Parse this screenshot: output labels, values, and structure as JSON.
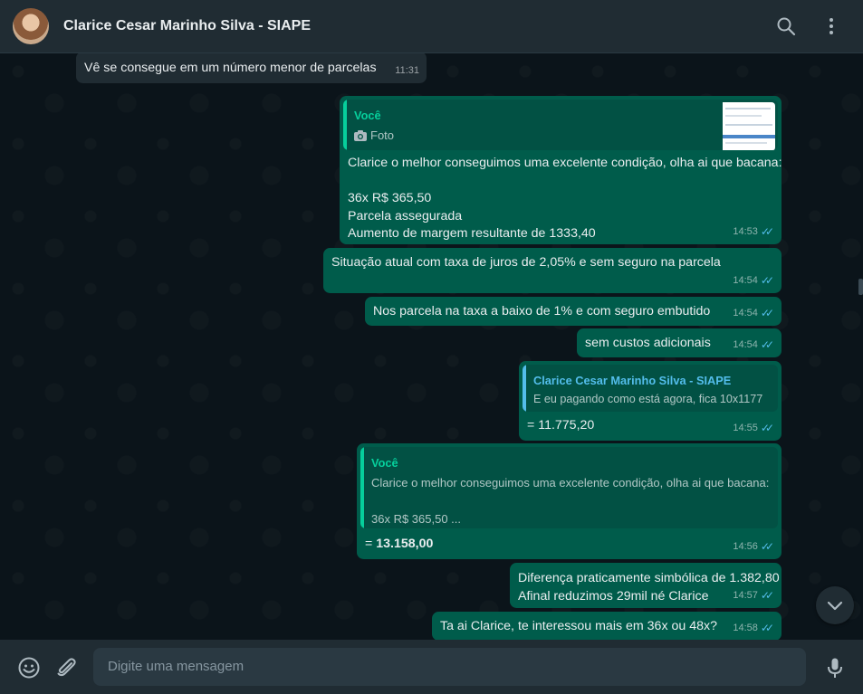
{
  "header": {
    "contact_name": "Clarice Cesar Marinho Silva - SIAPE"
  },
  "messages": {
    "m1": {
      "text": "Vê se consegue em um número menor de parcelas",
      "time": "11:31"
    },
    "m2": {
      "quote_author": "Você",
      "quote_text": "Foto",
      "text": "Clarice o melhor conseguimos uma excelente condição, olha ai que bacana:\n\n36x R$ 365,50\nParcela assegurada\nAumento de margem resultante de 1333,40",
      "time": "14:53"
    },
    "m3": {
      "text": "Situação atual com taxa de juros de 2,05% e sem seguro na parcela",
      "time": "14:54"
    },
    "m4": {
      "text": "Nos parcela na taxa a baixo de 1% e com seguro embutido",
      "time": "14:54"
    },
    "m5": {
      "text": "sem custos adicionais",
      "time": "14:54"
    },
    "m6": {
      "quote_author": "Clarice Cesar Marinho Silva - SIAPE",
      "quote_text": "E eu pagando como está agora, fica 10x1177",
      "text": "= 11.775,20",
      "time": "14:55"
    },
    "m7": {
      "quote_author": "Você",
      "quote_text_1": "Clarice o melhor conseguimos uma excelente condição, olha ai que bacana:",
      "quote_text_2": "36x R$ 365,50 ...",
      "text_prefix": "= ",
      "text_bold": "13.158,00",
      "time": "14:56"
    },
    "m8": {
      "text": "Diferença praticamente simbólica de 1.382,80\nAfinal reduzimos 29mil né Clarice",
      "time": "14:57"
    },
    "m9": {
      "text": "Ta ai Clarice, te interessou mais em 36x ou 48x?",
      "time": "14:58"
    }
  },
  "composer": {
    "placeholder": "Digite uma mensagem"
  },
  "colors": {
    "outgoing": "#005c4b",
    "incoming": "#202c33",
    "read_ticks": "#53bdeb",
    "accent": "#06cf9c"
  },
  "icons": [
    "search-icon",
    "menu-icon",
    "camera-icon",
    "emoji-icon",
    "attach-icon",
    "mic-icon",
    "chevron-down-icon",
    "double-check-icon"
  ]
}
